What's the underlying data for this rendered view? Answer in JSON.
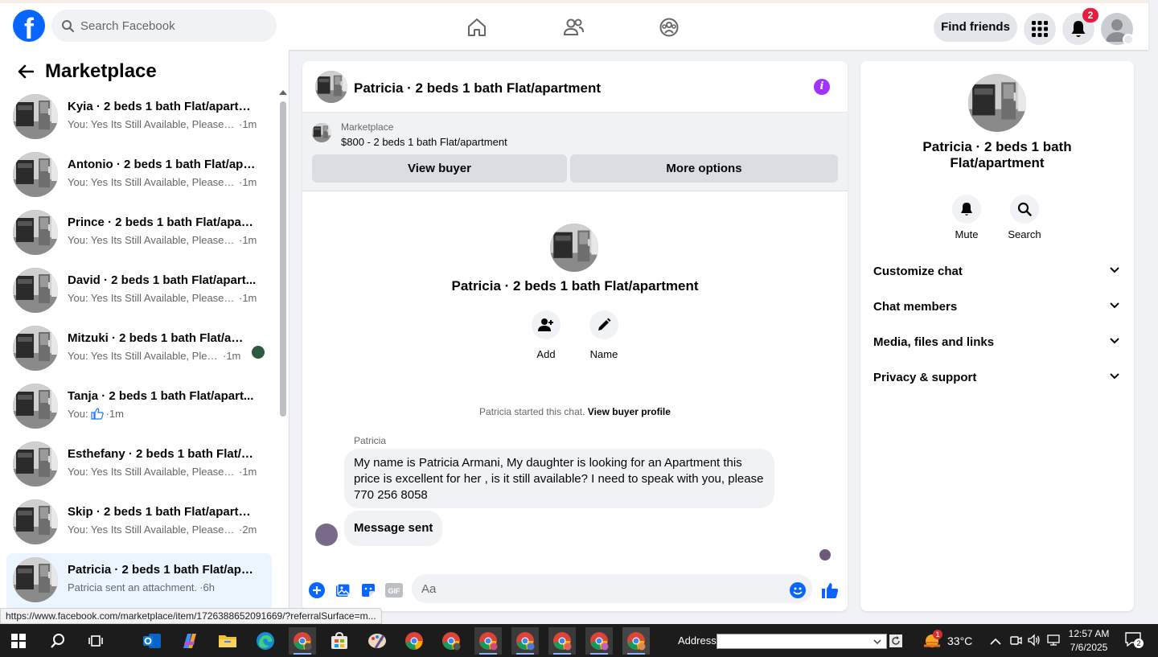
{
  "header": {
    "logo_letter": "f",
    "search_placeholder": "Search Facebook",
    "find_friends_label": "Find friends",
    "notification_count": "2"
  },
  "sidebar": {
    "title": "Marketplace",
    "conversations": [
      {
        "title": "Kyia · 2 beds 1 bath Flat/apartm...",
        "snippet": "You: Yes Its Still Available, Please S...",
        "time": "·1m"
      },
      {
        "title": "Antonio · 2 beds 1 bath Flat/apa...",
        "snippet": "You: Yes Its Still Available, Please S...",
        "time": "·1m"
      },
      {
        "title": "Prince · 2 beds 1 bath Flat/apart...",
        "snippet": "You: Yes Its Still Available, Please S...",
        "time": "·1m"
      },
      {
        "title": "David · 2 beds 1 bath Flat/apart...",
        "snippet": "You: Yes Its Still Available, Please S...",
        "time": "·1m"
      },
      {
        "title": "Mitzuki · 2 beds 1 bath Flat/ap...",
        "snippet": "You: Yes Its Still Available, Pleas...",
        "time": "·1m"
      },
      {
        "title": "Tanja · 2 beds 1 bath Flat/apart...",
        "snippet": "You:",
        "time": "·1m"
      },
      {
        "title": "Esthefany · 2 beds 1 bath Flat/ap...",
        "snippet": "You: Yes Its Still Available, Please S...",
        "time": "·1m"
      },
      {
        "title": "Skip · 2 beds 1 bath Flat/apartm...",
        "snippet": "You: Yes Its Still Available, Please S...",
        "time": "·2m"
      },
      {
        "title": "Patricia · 2 beds 1 bath Flat/apar...",
        "snippet": "Patricia sent an attachment.",
        "time": "·6h"
      }
    ]
  },
  "chat": {
    "title": "Patricia · 2 beds 1 bath Flat/apartment",
    "marketplace_label": "Marketplace",
    "listing": "$800 - 2 beds 1 bath Flat/apartment",
    "view_buyer_label": "View buyer",
    "more_options_label": "More options",
    "center_title": "Patricia · 2 beds 1 bath Flat/apartment",
    "add_label": "Add",
    "name_label": "Name",
    "started_text": "Patricia started this chat.",
    "view_buyer_profile": "View buyer profile",
    "sender_name": "Patricia",
    "message_1": "My name is Patricia Armani, My daughter is looking for an Apartment this price is excellent for her , is it still available? I need to speak with you, please 770 256 8058",
    "message_2": "Message sent",
    "composer_placeholder": "Aa",
    "gif_label": "GIF"
  },
  "right_panel": {
    "title": "Patricia · 2 beds 1 bath Flat/apartment",
    "mute_label": "Mute",
    "search_label": "Search",
    "sections": [
      "Customize chat",
      "Chat members",
      "Media, files and links",
      "Privacy & support"
    ]
  },
  "status_url": "https://www.facebook.com/marketplace/item/1726388652091669/?referralSurface=m...",
  "taskbar": {
    "address_label": "Address",
    "temperature": "33°C",
    "time": "12:57 AM",
    "date": "7/6/2025",
    "weather_badge": "1",
    "notif_count": "2"
  },
  "colors": {
    "brand_blue": "#0866ff",
    "messenger_purple": "#a033ff",
    "badge_red": "#e41e3f",
    "active_row": "#ebf5ff"
  }
}
